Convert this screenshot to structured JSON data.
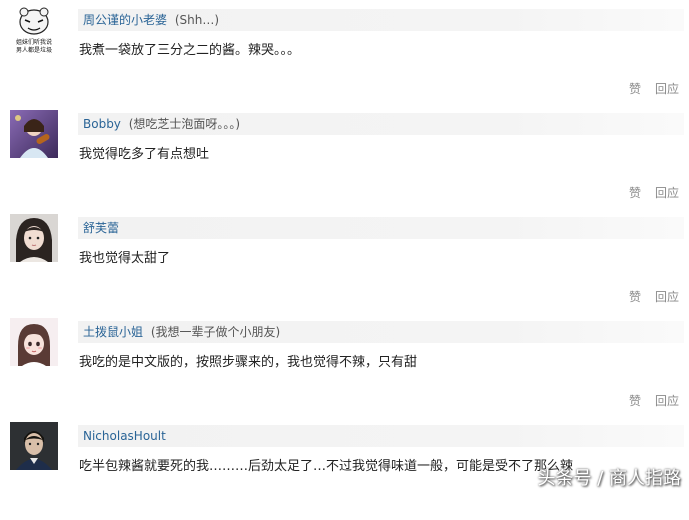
{
  "comments": [
    {
      "username": "周公谨的小老婆",
      "signature": "(Shh…)",
      "text": "我煮一袋放了三分之二的酱。辣哭。。。",
      "avatar_caption_line1": "姐妹们听我说",
      "avatar_caption_line2": "男人都是垃圾",
      "like_label": "赞",
      "reply_label": "回应"
    },
    {
      "username": "Bobby",
      "signature": "(想吃芝士泡面呀。。。)",
      "text": "我觉得吃多了有点想吐",
      "like_label": "赞",
      "reply_label": "回应"
    },
    {
      "username": "舒芙蕾",
      "signature": "",
      "text": "我也觉得太甜了",
      "like_label": "赞",
      "reply_label": "回应"
    },
    {
      "username": "土拨鼠小姐",
      "signature": "(我想一辈子做个小朋友)",
      "text": "我吃的是中文版的，按照步骤来的，我也觉得不辣，只有甜",
      "like_label": "赞",
      "reply_label": "回应"
    },
    {
      "username": "NicholasHoult",
      "signature": "",
      "text": "吃半包辣酱就要死的我………后劲太足了…不过我觉得味道一般，可能是受不了那么辣",
      "like_label": "赞",
      "reply_label": "回应"
    }
  ],
  "watermark": "头条号 / 商人指路"
}
